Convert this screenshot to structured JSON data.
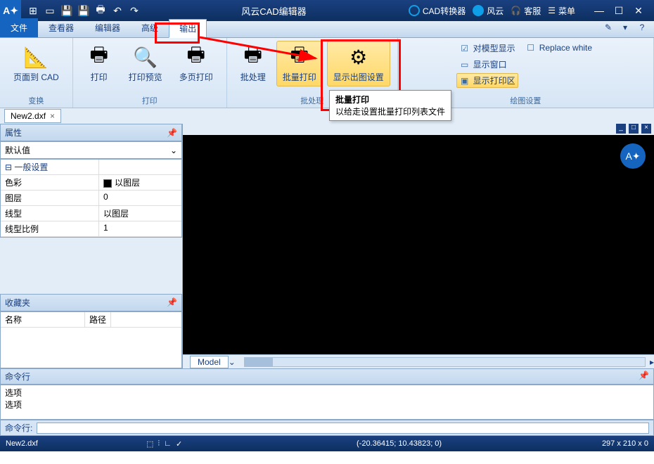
{
  "titlebar": {
    "app_title": "风云CAD编辑器",
    "converter": "CAD转换器",
    "fengyun": "风云",
    "support": "客服",
    "menu": "菜单"
  },
  "tabs": {
    "file": "文件",
    "viewer": "查看器",
    "editor": "编辑器",
    "advanced": "高级",
    "output": "输出"
  },
  "ribbon": {
    "group_convert": "变换",
    "page_to_cad": "页面到 CAD",
    "group_print": "打印",
    "print": "打印",
    "print_preview": "打印预览",
    "multi_print": "多页打印",
    "group_batch": "批处理",
    "batch": "批处理",
    "batch_print": "批量打印",
    "plot_settings": "显示出图设置",
    "group_draw": "绘图设置",
    "model_display": "对模型显示",
    "display_window": "显示窗口",
    "display_print_area": "显示打印区",
    "replace_white": "Replace white"
  },
  "tooltip": {
    "title": "批量打印",
    "desc": "以给走设置批量打印列表文件"
  },
  "doctab": {
    "name": "New2.dxf"
  },
  "properties": {
    "header": "属性",
    "default": "默认值",
    "general": "一般设置",
    "color_k": "色彩",
    "color_v": "以图层",
    "layer_k": "图层",
    "layer_v": "0",
    "linetype_k": "线型",
    "linetype_v": "以图层",
    "ltscale_k": "线型比例",
    "ltscale_v": "1"
  },
  "favorites": {
    "header": "收藏夹",
    "col_name": "名称",
    "col_path": "路径"
  },
  "model_tab": "Model",
  "command": {
    "header": "命令行",
    "line1": "选项",
    "line2": "选项",
    "prompt": "命令行:"
  },
  "statusbar": {
    "file": "New2.dxf",
    "coords": "(-20.36415; 10.43823; 0)",
    "dims": "297 x 210 x 0"
  }
}
